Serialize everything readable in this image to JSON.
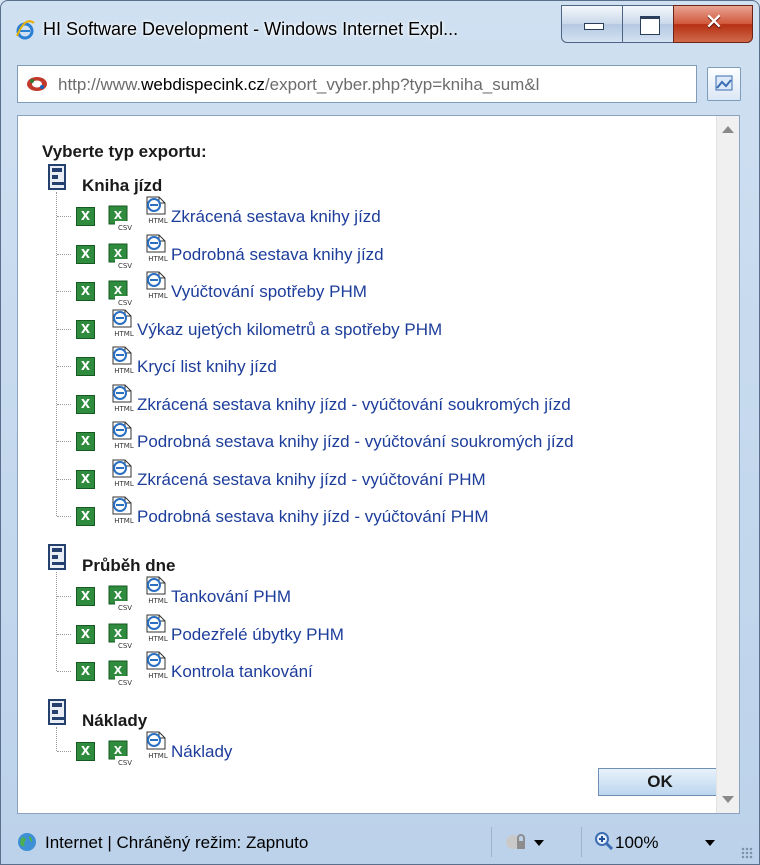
{
  "window": {
    "title": "HI Software Development - Windows Internet Expl..."
  },
  "address": {
    "url_prefix": "http://www.",
    "url_domain": "webdispecink.cz",
    "url_rest": "/export_vyber.php?typ=kniha_sum&l"
  },
  "heading": "Vyberte typ exportu:",
  "categories": [
    {
      "label": "Kniha jízd",
      "items": [
        {
          "label": "Zkrácená sestava knihy jízd",
          "formats": [
            "xls",
            "csv",
            "html"
          ]
        },
        {
          "label": "Podrobná sestava knihy jízd",
          "formats": [
            "xls",
            "csv",
            "html"
          ]
        },
        {
          "label": "Vyúčtování spotřeby PHM",
          "formats": [
            "xls",
            "csv",
            "html"
          ]
        },
        {
          "label": "Výkaz ujetých kilometrů a spotřeby PHM",
          "formats": [
            "xls",
            "html"
          ]
        },
        {
          "label": "Krycí list knihy jízd",
          "formats": [
            "xls",
            "html"
          ]
        },
        {
          "label": "Zkrácená sestava knihy jízd - vyúčtování soukromých jízd",
          "formats": [
            "xls",
            "html"
          ]
        },
        {
          "label": "Podrobná sestava knihy jízd - vyúčtování soukromých jízd",
          "formats": [
            "xls",
            "html"
          ]
        },
        {
          "label": "Zkrácená sestava knihy jízd - vyúčtování PHM",
          "formats": [
            "xls",
            "html"
          ]
        },
        {
          "label": "Podrobná sestava knihy jízd - vyúčtování PHM",
          "formats": [
            "xls",
            "html"
          ]
        }
      ]
    },
    {
      "label": "Průběh dne",
      "items": [
        {
          "label": "Tankování PHM",
          "formats": [
            "xls",
            "csv",
            "html"
          ]
        },
        {
          "label": "Podezřelé úbytky PHM",
          "formats": [
            "xls",
            "csv",
            "html"
          ]
        },
        {
          "label": "Kontrola tankování",
          "formats": [
            "xls",
            "csv",
            "html"
          ]
        }
      ]
    },
    {
      "label": "Náklady",
      "items": [
        {
          "label": "Náklady",
          "formats": [
            "xls",
            "csv",
            "html"
          ]
        }
      ]
    }
  ],
  "ok_label": "OK",
  "status": {
    "zone": "Internet | Chráněný režim: Zapnuto",
    "zoom": "100%"
  },
  "icons": {
    "xls": "excel-icon",
    "csv": "csv-icon",
    "html": "ie-html-icon",
    "folder": "folder-icon"
  }
}
